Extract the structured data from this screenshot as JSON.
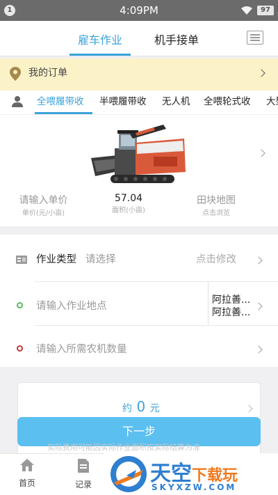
{
  "status_bar": {
    "notification": "1",
    "time": "4:09PM",
    "battery": "97"
  },
  "header": {
    "tabs": [
      {
        "label": "雇车作业",
        "active": true
      },
      {
        "label": "机手接单",
        "active": false
      }
    ]
  },
  "orders_bar": {
    "label": "我的订单"
  },
  "categories": {
    "items": [
      "全喂履带收",
      "半喂履带收",
      "无人机",
      "全喂轮式收",
      "大型"
    ],
    "active_index": 0
  },
  "machine": {
    "price": {
      "value": "请输入单价",
      "sub": "单价(元/小亩)"
    },
    "area": {
      "value": "57.04",
      "sub": "面积(小亩)"
    },
    "map": {
      "value": "田块地图",
      "sub": "点击浏览"
    }
  },
  "form": {
    "job_type": {
      "label": "作业类型",
      "placeholder": "请选择",
      "hint": "点击修改"
    },
    "location": {
      "placeholder": "请输入作业地点",
      "line1": "阿拉善...",
      "line2": "阿拉善..."
    },
    "quantity": {
      "placeholder": "请输入所需农机数量"
    }
  },
  "price_card": {
    "prefix": "约",
    "amount": "0",
    "unit": "元",
    "faint_text": "实际费用可能因实际作业面积按实际结算为准"
  },
  "next_button": {
    "label": "下一步"
  },
  "bottom_nav": {
    "items": [
      {
        "label": "首页",
        "icon": "home-icon"
      },
      {
        "label": "记录",
        "icon": "document-icon"
      }
    ]
  },
  "watermark": {
    "title_main": "天空",
    "title_accent": "下载玩",
    "subtitle": "SKYXZW.COM"
  },
  "colors": {
    "accent": "#3ba3d9",
    "button": "#5bbff0",
    "orders_bg": "#fbf2c8",
    "status_bar": "#6b6b6b"
  }
}
